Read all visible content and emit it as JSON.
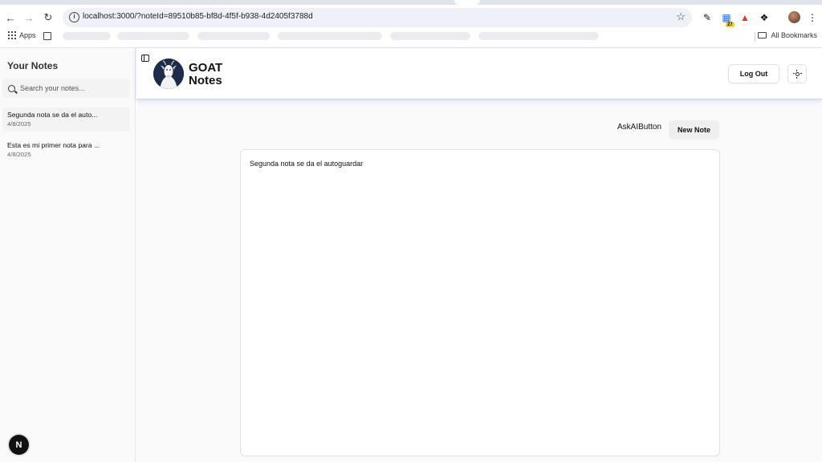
{
  "browser": {
    "url": "localhost:3000/?noteId=89510b85-bf8d-4f5f-b938-4d2405f3788d",
    "extension_badge": "27",
    "bookmarks": {
      "apps_label": "Apps",
      "all_bookmarks_label": "All Bookmarks"
    }
  },
  "sidebar": {
    "title": "Your Notes",
    "search_placeholder": "Search your notes...",
    "notes": [
      {
        "title": "Segunda nota se da el auto...",
        "date": "4/8/2025",
        "active": true
      },
      {
        "title": "Esta es mi primer nota para ...",
        "date": "4/8/2025",
        "active": false
      }
    ],
    "dev_badge": "N"
  },
  "header": {
    "brand_line1": "GOAT",
    "brand_line2": "Notes",
    "logout_label": "Log Out"
  },
  "main": {
    "ask_ai_label": "AskAIButton",
    "new_note_label": "New Note",
    "editor_text": "Segunda nota se da el autoguardar"
  },
  "colors": {
    "header_shadow": "#c9d4f2",
    "logo_bg": "#1d2c4a",
    "sidebar_bg": "#fafafa"
  }
}
